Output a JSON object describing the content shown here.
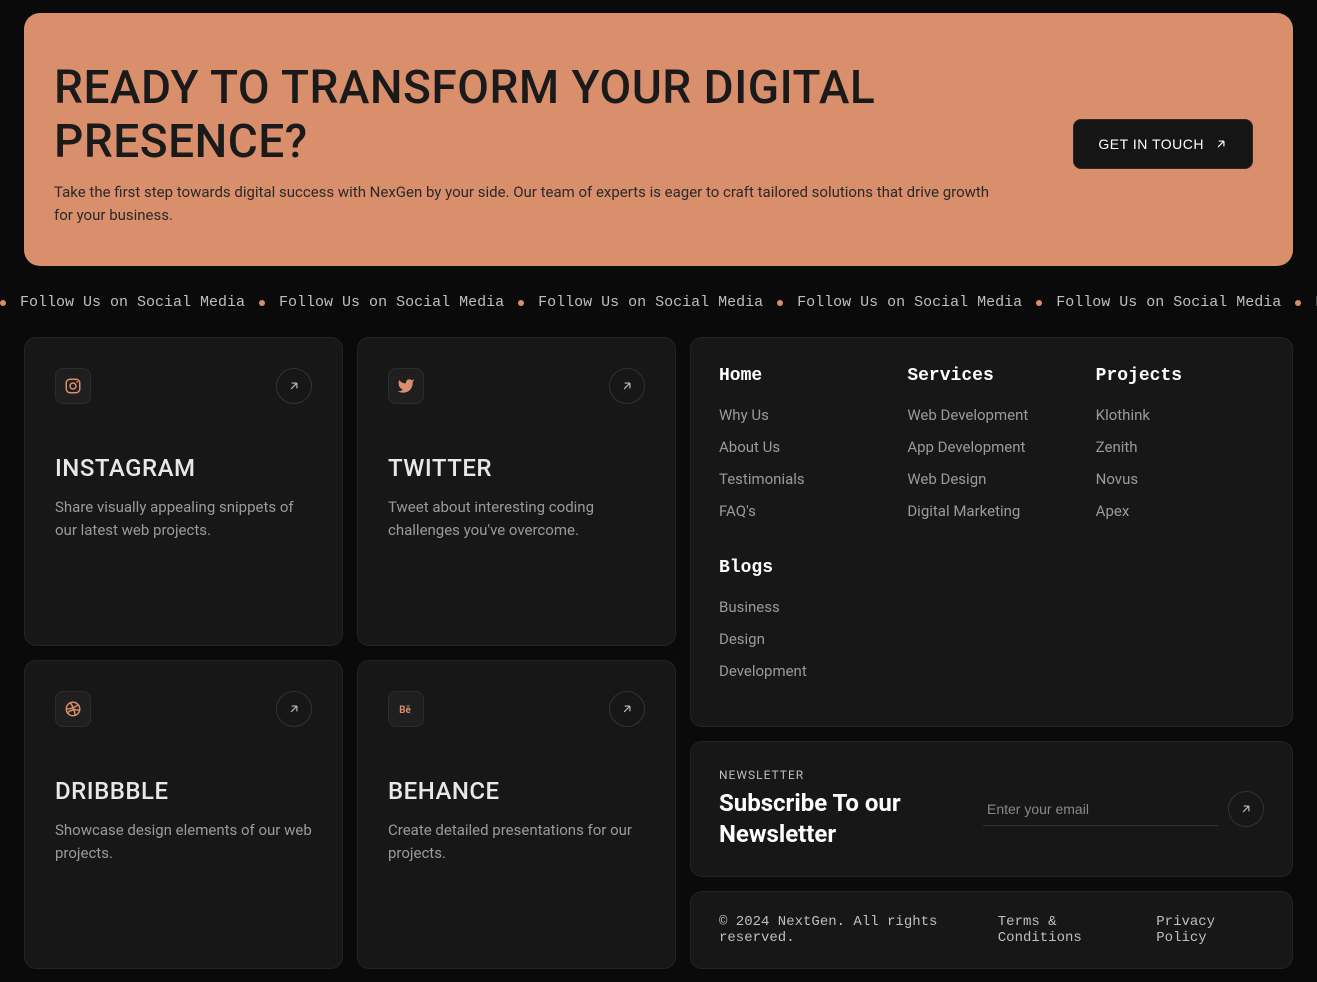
{
  "cta": {
    "title": "READY TO TRANSFORM YOUR DIGITAL PRESENCE?",
    "subtitle": "Take the first step towards digital success with NexGen by your side. Our team of experts is eager to craft tailored solutions that drive growth for your business.",
    "button": "GET IN TOUCH"
  },
  "marquee_text": "Follow Us on Social Media",
  "social_cards": [
    {
      "title": "INSTAGRAM",
      "desc": "Share visually appealing snippets of our latest web projects.",
      "icon": "instagram-icon"
    },
    {
      "title": "TWITTER",
      "desc": "Tweet about interesting coding challenges you've overcome.",
      "icon": "twitter-icon"
    },
    {
      "title": "DRIBBBLE",
      "desc": "Showcase design elements of our web projects.",
      "icon": "dribbble-icon"
    },
    {
      "title": "BEHANCE",
      "desc": "Create detailed presentations for our projects.",
      "icon": "behance-icon"
    }
  ],
  "footer": {
    "cols": [
      {
        "heading": "Home",
        "links": [
          "Why Us",
          "About Us",
          "Testimonials",
          "FAQ's"
        ]
      },
      {
        "heading": "Services",
        "links": [
          "Web Development",
          "App Development",
          "Web Design",
          "Digital Marketing"
        ]
      },
      {
        "heading": "Projects",
        "links": [
          "Klothink",
          "Zenith",
          "Novus",
          "Apex"
        ]
      },
      {
        "heading": "Blogs",
        "links": [
          "Business",
          "Design",
          "Development"
        ]
      }
    ]
  },
  "newsletter": {
    "label": "NEWSLETTER",
    "title": "Subscribe To our Newsletter",
    "placeholder": "Enter your email"
  },
  "legal": {
    "copyright": "© 2024 NextGen. All rights reserved.",
    "links": [
      "Terms & Conditions",
      "Privacy Policy"
    ]
  }
}
